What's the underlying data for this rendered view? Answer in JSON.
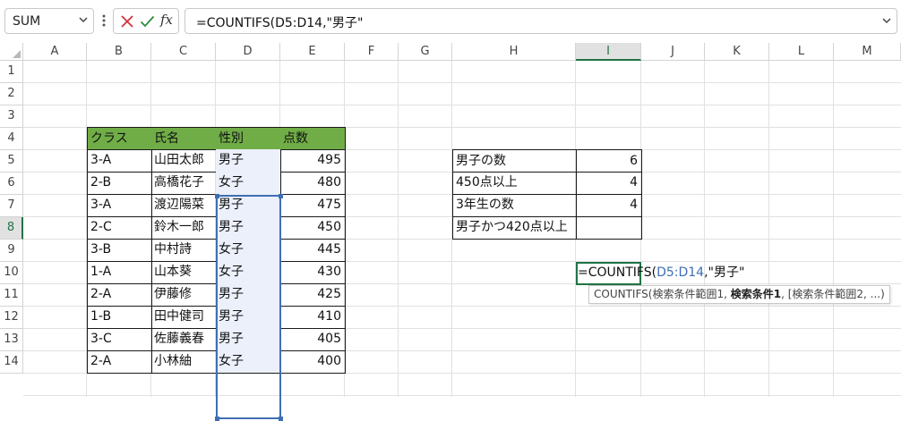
{
  "name_box": {
    "value": "SUM"
  },
  "formula_bar": {
    "fx_label": "fx",
    "formula": "=COUNTIFS(D5:D14,\"男子\""
  },
  "columns": [
    "A",
    "B",
    "C",
    "D",
    "E",
    "F",
    "G",
    "H",
    "I",
    "J",
    "K",
    "L",
    "M"
  ],
  "rows": [
    "1",
    "2",
    "3",
    "4",
    "5",
    "6",
    "7",
    "8",
    "9",
    "10",
    "11",
    "12",
    "13",
    "14"
  ],
  "table": {
    "headers": [
      "クラス",
      "氏名",
      "性別",
      "点数"
    ],
    "rows": [
      [
        "3-A",
        "山田太郎",
        "男子",
        "495"
      ],
      [
        "2-B",
        "高橋花子",
        "女子",
        "480"
      ],
      [
        "3-A",
        "渡辺陽菜",
        "男子",
        "475"
      ],
      [
        "2-C",
        "鈴木一郎",
        "男子",
        "450"
      ],
      [
        "3-B",
        "中村詩",
        "女子",
        "445"
      ],
      [
        "1-A",
        "山本葵",
        "女子",
        "430"
      ],
      [
        "2-A",
        "伊藤修",
        "男子",
        "425"
      ],
      [
        "1-B",
        "田中健司",
        "男子",
        "410"
      ],
      [
        "3-C",
        "佐藤義春",
        "男子",
        "405"
      ],
      [
        "2-A",
        "小林紬",
        "女子",
        "400"
      ]
    ]
  },
  "summary": {
    "rows": [
      [
        "男子の数",
        "6"
      ],
      [
        "450点以上",
        "4"
      ],
      [
        "3年生の数",
        "4"
      ],
      [
        "男子かつ420点以上",
        ""
      ]
    ]
  },
  "edit": {
    "prefix": "=COUNTIFS(",
    "ref": "D5:D14",
    "suffix": ",\"男子\""
  },
  "tooltip": {
    "func": "COUNTIFS(検索条件範囲1, ",
    "bold": "検索条件1",
    "rest": ", [検索条件範囲2, ...)"
  },
  "colors": {
    "header_green": "#70ad47",
    "ref_blue": "#3e6fb5",
    "select_green": "#217346"
  }
}
